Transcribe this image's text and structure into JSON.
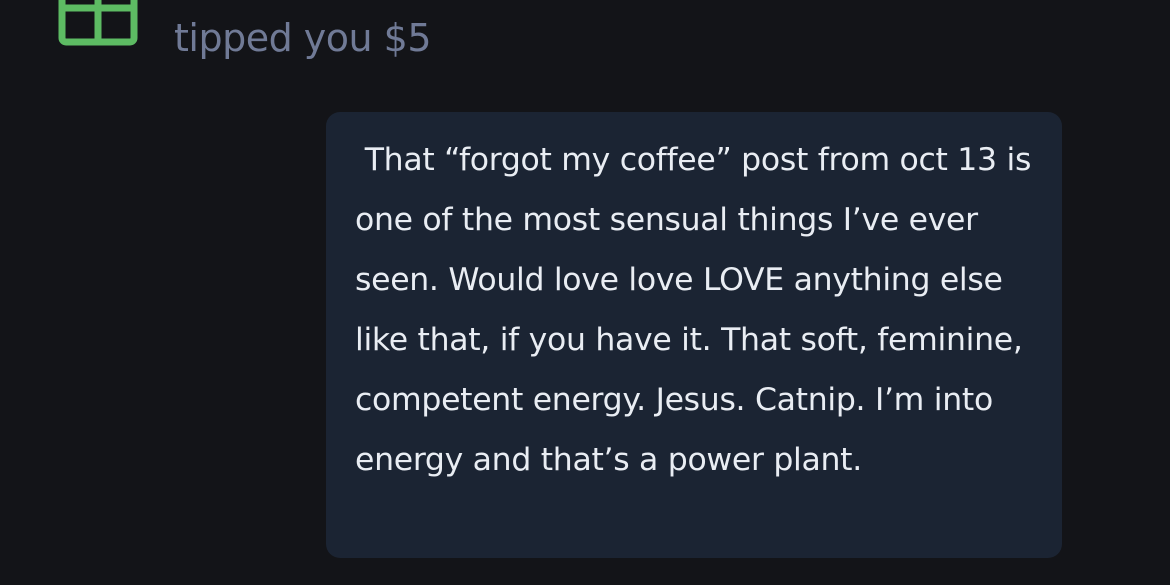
{
  "tip": {
    "icon": "gift-icon",
    "icon_color": "#5dbb63",
    "text": "tipped you $5"
  },
  "message": {
    "text": " That “forgot my coffee” post from oct 13 is one of the most sensual things I’ve ever seen. Would love love LOVE anything else like that, if you have it. That soft, feminine, competent energy. Jesus. Catnip. I’m into energy and that’s a power plant.",
    "bubble_color": "#1b2433",
    "text_color": "#e9edf3"
  },
  "colors": {
    "background": "#131418",
    "muted_text": "#707a96"
  }
}
